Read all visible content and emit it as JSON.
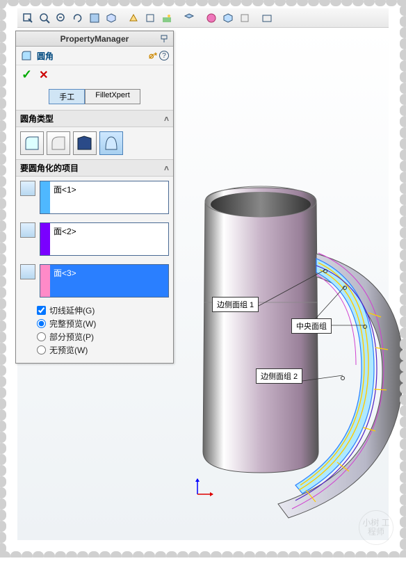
{
  "pm": {
    "title": "PropertyManager"
  },
  "cmd": {
    "name": "圆角"
  },
  "tabs": {
    "manual": "手工",
    "fx": "FilletXpert"
  },
  "section": {
    "type": "圆角类型",
    "items": "要圆角化的项目"
  },
  "faces": {
    "f1": "面<1>",
    "f2": "面<2>",
    "f3": "面<3>"
  },
  "opts": {
    "tangent": "切线延伸(G)",
    "full": "完整预览(W)",
    "partial": "部分预览(P)",
    "none": "无预览(W)"
  },
  "callouts": {
    "side1": "边侧面组 1",
    "center": "中央面组",
    "side2": "边侧面组 2"
  },
  "watermark": "小树\n工程师"
}
